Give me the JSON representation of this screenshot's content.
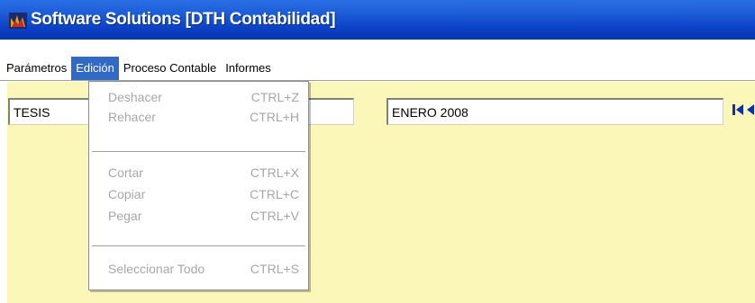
{
  "window": {
    "title": "Software Solutions [DTH Contabilidad]",
    "icon": "app-logo-icon"
  },
  "menubar": {
    "items": [
      {
        "label": "Parámetros"
      },
      {
        "label": "Edición"
      },
      {
        "label": "Proceso Contable"
      },
      {
        "label": "Informes"
      }
    ],
    "active": "Edición"
  },
  "fields": {
    "empresa": "TESIS",
    "periodo": "ENERO 2008"
  },
  "navigation": {
    "icons": [
      "first-record-icon",
      "previous-record-icon",
      "next-record-icon",
      "last-record-icon"
    ]
  },
  "edit_menu": {
    "items": [
      {
        "label": "Deshacer",
        "shortcut": "CTRL+Z"
      },
      {
        "label": "Rehacer",
        "shortcut": "CTRL+H"
      },
      {
        "label": "Cortar",
        "shortcut": "CTRL+X"
      },
      {
        "label": "Copiar",
        "shortcut": "CTRL+C"
      },
      {
        "label": "Pegar",
        "shortcut": "CTRL+V"
      },
      {
        "label": "Seleccionar Todo",
        "shortcut": "CTRL+S"
      }
    ]
  },
  "colors": {
    "titlebar": "#1e5fd9",
    "menu_highlight": "#316ac5",
    "workspace": "#fbf7b9",
    "disabled_text": "#a7a7a7",
    "nav_icon": "#0a2fb0"
  }
}
